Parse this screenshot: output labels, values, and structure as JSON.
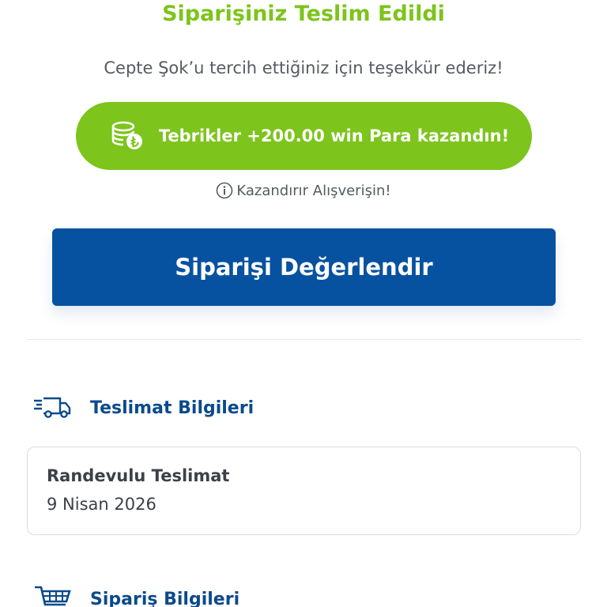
{
  "header": {
    "title": "Siparişiniz Teslim Edildi",
    "subtitle": "Cepte Şok’u tercih ettiğiniz için teşekkür ederiz!"
  },
  "reward": {
    "icon": "coins-lira-icon",
    "text": "Tebrikler +200.00 win Para kazandın!",
    "color": "#7dc41c"
  },
  "info": {
    "icon": "info-icon",
    "text": "Kazandırır Alışverişin!"
  },
  "rate_button": {
    "label": "Siparişi Değerlendir",
    "color": "#0752a0"
  },
  "delivery_section": {
    "icon": "delivery-truck-icon",
    "label": "Teslimat Bilgileri",
    "card": {
      "title": "Randevulu Teslimat",
      "date": "9 Nisan 2026"
    }
  },
  "order_section": {
    "icon": "shopping-cart-icon",
    "label": "Sipariş Bilgileri"
  }
}
